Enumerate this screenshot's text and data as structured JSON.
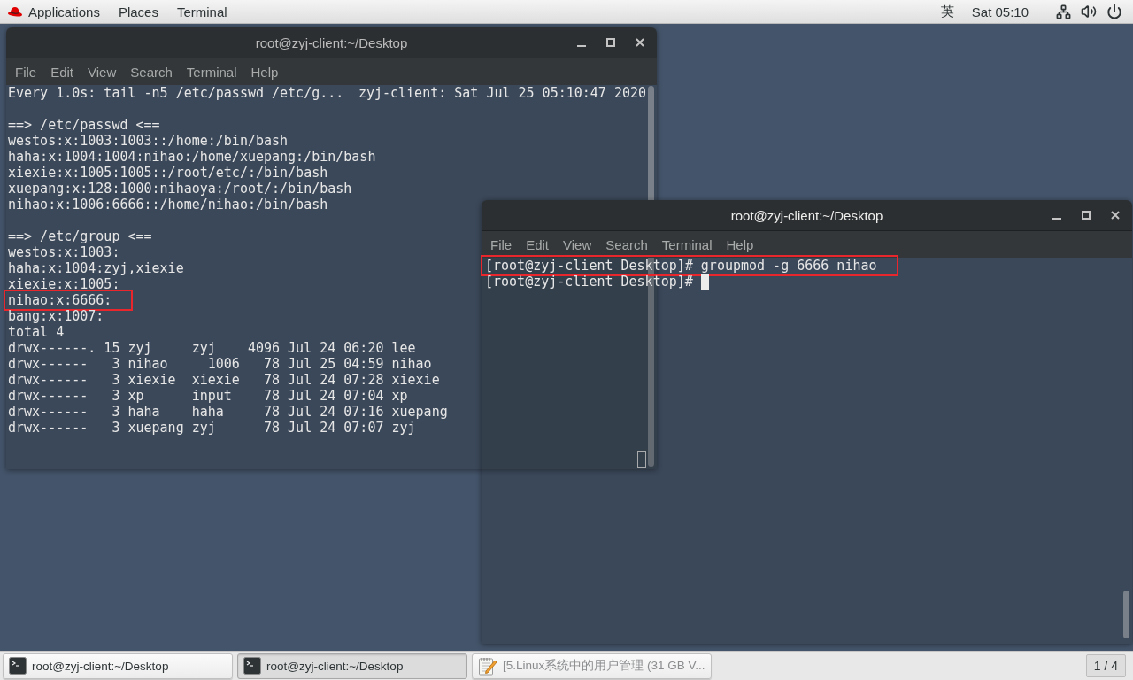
{
  "top_bar": {
    "menus": [
      "Applications",
      "Places",
      "Terminal"
    ],
    "input_method": "英",
    "clock": "Sat 05:10"
  },
  "windows": [
    {
      "title": "root@zyj-client:~/Desktop",
      "focused": false,
      "menu": [
        "File",
        "Edit",
        "View",
        "Search",
        "Terminal",
        "Help"
      ],
      "header": {
        "command": "Every 1.0s: tail -n5 /etc/passwd /etc/g...",
        "host_time": "zyj-client: Sat Jul 25 05:10:47 2020"
      },
      "blocks": [
        {
          "heading": "==> /etc/passwd <==",
          "lines": [
            {
              "text": "westos:x:1003:1003::/home:/bin/bash",
              "highlighted": false
            },
            {
              "text": "haha:x:1004:1004:nihao:/home/xuepang:/bin/bash",
              "highlighted": false
            },
            {
              "text": "xiexie:x:1005:1005::/root/etc/:/bin/bash",
              "highlighted": false
            },
            {
              "text": "xuepang:x:128:1000:nihaoya:/root/:/bin/bash",
              "highlighted": false
            },
            {
              "text": "nihao:x:1006:6666::/home/nihao:/bin/bash",
              "highlighted": false
            }
          ]
        },
        {
          "heading": "==> /etc/group <==",
          "lines": [
            {
              "text": "westos:x:1003:",
              "highlighted": false
            },
            {
              "text": "haha:x:1004:zyj,xiexie",
              "highlighted": false
            },
            {
              "text": "xiexie:x:1005:",
              "highlighted": false
            },
            {
              "text": "nihao:x:6666:",
              "highlighted": true
            },
            {
              "text": "bang:x:1007:",
              "highlighted": false
            }
          ]
        },
        {
          "lines": [
            {
              "text": "total 4",
              "highlighted": false
            },
            {
              "text": "drwx------. 15 zyj     zyj    4096 Jul 24 06:20 lee",
              "highlighted": false
            },
            {
              "text": "drwx------   3 nihao     1006   78 Jul 25 04:59 nihao",
              "highlighted": false
            },
            {
              "text": "drwx------   3 xiexie  xiexie   78 Jul 24 07:28 xiexie",
              "highlighted": false
            },
            {
              "text": "drwx------   3 xp      input    78 Jul 24 07:04 xp",
              "highlighted": false
            },
            {
              "text": "drwx------   3 haha    haha     78 Jul 24 07:16 xuepang",
              "highlighted": false
            },
            {
              "text": "drwx------   3 xuepang zyj      78 Jul 24 07:07 zyj",
              "highlighted": false
            }
          ]
        }
      ]
    },
    {
      "title": "root@zyj-client:~/Desktop",
      "focused": true,
      "menu": [
        "File",
        "Edit",
        "View",
        "Search",
        "Terminal",
        "Help"
      ],
      "lines": [
        {
          "text": "[root@zyj-client Desktop]# groupmod -g 6666 nihao",
          "highlighted": true
        },
        {
          "text": "[root@zyj-client Desktop]#",
          "highlighted": false
        }
      ]
    }
  ],
  "taskbar": {
    "tasks": [
      {
        "kind": "terminal",
        "label": "root@zyj-client:~/Desktop",
        "selected": false,
        "minimized": false
      },
      {
        "kind": "terminal",
        "label": "root@zyj-client:~/Desktop",
        "selected": true,
        "minimized": false
      },
      {
        "kind": "editor",
        "label": "[5.Linux系统中的用户管理 (31 GB V...",
        "selected": false,
        "minimized": true
      }
    ],
    "workspace": "1 / 4"
  }
}
